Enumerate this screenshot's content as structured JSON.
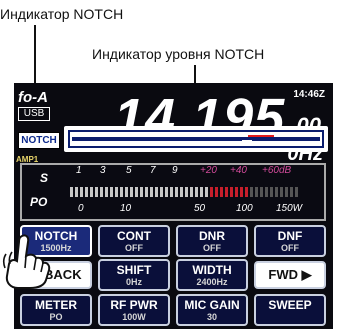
{
  "callouts": {
    "notch_indicator": "Индикатор NOTCH",
    "notch_level_indicator": "Индикатор уровня NOTCH"
  },
  "display": {
    "vfo": "fo-A",
    "mode": "USB",
    "clock": "14:46Z",
    "freq_main": "14.195",
    "freq_small": "00",
    "hz": "0Hz",
    "notch_tag": "NOTCH",
    "amp_label": "AMP1"
  },
  "meter": {
    "s_label": "S",
    "po_label": "PO",
    "s_ticks": [
      "1",
      "3",
      "5",
      "7",
      "9",
      "+20",
      "+40",
      "+60dB"
    ],
    "po_ticks": [
      "0",
      "10",
      "50",
      "100",
      "150W"
    ]
  },
  "buttons": [
    {
      "top": "NOTCH",
      "bot": "1500Hz"
    },
    {
      "top": "CONT",
      "bot": "OFF"
    },
    {
      "top": "DNR",
      "bot": "OFF"
    },
    {
      "top": "DNF",
      "bot": "OFF"
    },
    {
      "top": "SHIFT",
      "bot": "0Hz"
    },
    {
      "top": "WIDTH",
      "bot": "2400Hz"
    },
    {
      "top": "METER",
      "bot": "PO"
    },
    {
      "top": "RF PWR",
      "bot": "100W"
    },
    {
      "top": "MIC GAIN",
      "bot": "30"
    },
    {
      "top": "SWEEP",
      "bot": ""
    }
  ],
  "nav": {
    "back": "BACK",
    "fwd": "FWD"
  },
  "colors": {
    "panel": "#0a0f3a",
    "notch_marker": "#e21b1b",
    "s_plus_ticks": "#d14b9a"
  }
}
